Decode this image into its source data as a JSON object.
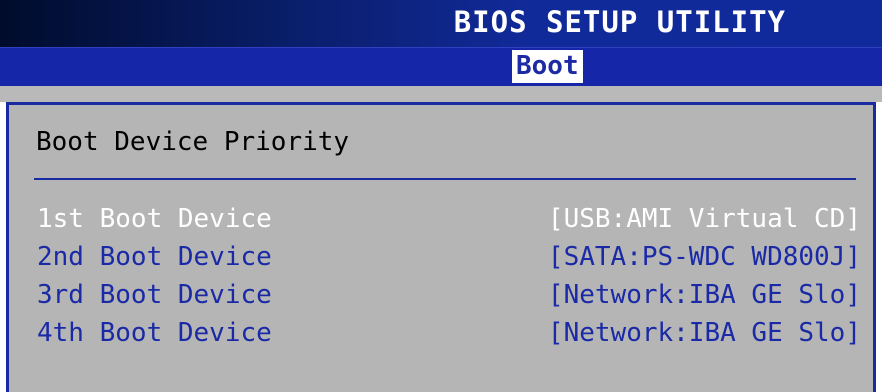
{
  "title": "BIOS SETUP UTILITY",
  "menu": {
    "active_tab": "Boot"
  },
  "section": {
    "title": "Boot Device Priority"
  },
  "boot_devices": [
    {
      "label": "1st Boot Device",
      "value": "[USB:AMI Virtual CD]",
      "selected": true
    },
    {
      "label": "2nd Boot Device",
      "value": "[SATA:PS-WDC WD800J]",
      "selected": false
    },
    {
      "label": "3rd Boot Device",
      "value": "[Network:IBA GE Slo]",
      "selected": false
    },
    {
      "label": "4th Boot Device",
      "value": "[Network:IBA GE Slo]",
      "selected": false
    }
  ],
  "colors": {
    "menu_bar": "#1626a8",
    "panel_background": "#b5b5b5",
    "item_text": "#1a2aa6",
    "selected_text": "#ffffff"
  }
}
